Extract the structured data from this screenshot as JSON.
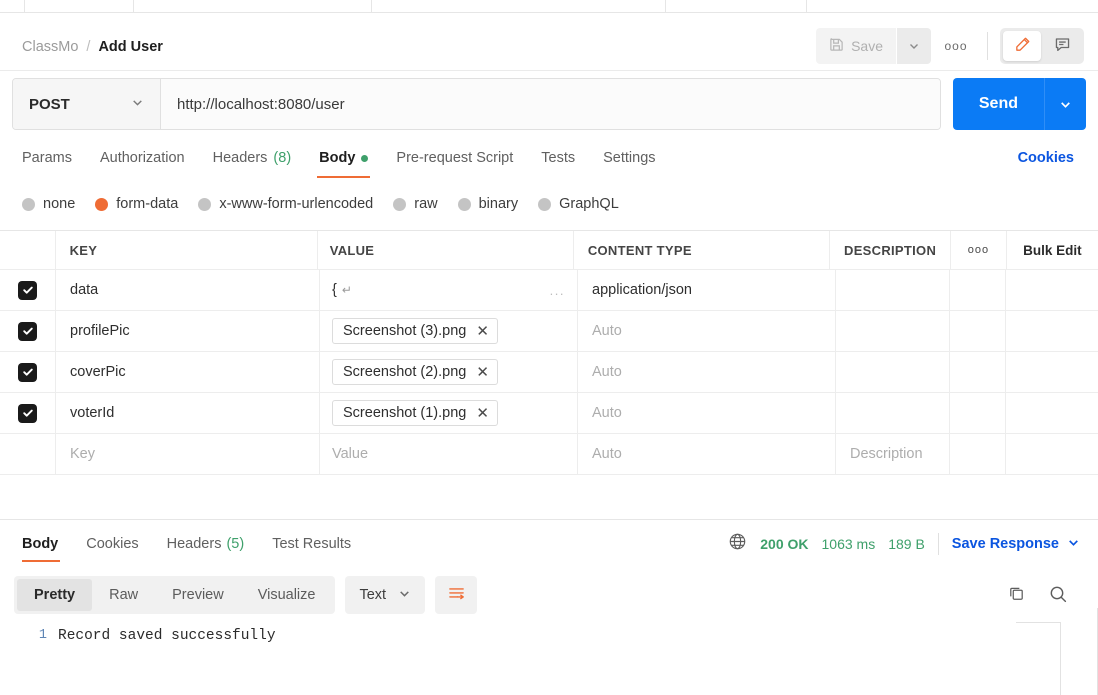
{
  "header": {
    "breadcrumb_collection": "ClassMo",
    "breadcrumb_separator": "/",
    "breadcrumb_request": "Add User",
    "save_label": "Save",
    "save_caret_icon": "chevron-down-icon",
    "more_label": "ooo",
    "edit_icon": "pencil-icon",
    "comment_icon": "comment-icon"
  },
  "request": {
    "method": "POST",
    "method_caret": "chevron-down-icon",
    "url": "http://localhost:8080/user",
    "send_label": "Send",
    "send_caret_icon": "chevron-down-icon",
    "tabs": [
      {
        "label": "Params",
        "count": "",
        "active": false
      },
      {
        "label": "Authorization",
        "count": "",
        "active": false
      },
      {
        "label": "Headers",
        "count": "(8)",
        "active": false
      },
      {
        "label": "Body",
        "count": "",
        "active": true
      },
      {
        "label": "Pre-request Script",
        "count": "",
        "active": false
      },
      {
        "label": "Tests",
        "count": "",
        "active": false
      },
      {
        "label": "Settings",
        "count": "",
        "active": false
      }
    ],
    "cookies_link": "Cookies",
    "body_types": [
      {
        "label": "none",
        "selected": false
      },
      {
        "label": "form-data",
        "selected": true
      },
      {
        "label": "x-www-form-urlencoded",
        "selected": false
      },
      {
        "label": "raw",
        "selected": false
      },
      {
        "label": "binary",
        "selected": false
      },
      {
        "label": "GraphQL",
        "selected": false
      }
    ]
  },
  "form_data_table": {
    "headers": {
      "key": "KEY",
      "value": "VALUE",
      "content_type": "CONTENT TYPE",
      "description": "DESCRIPTION",
      "options_icon": "ooo",
      "bulk_edit": "Bulk Edit"
    },
    "rows": [
      {
        "checked": true,
        "key": "data",
        "value": "{",
        "value_is_file": false,
        "value_return_glyph": "↵",
        "value_overflow": "...",
        "content_type": "application/json",
        "content_type_is_placeholder": false,
        "description": ""
      },
      {
        "checked": true,
        "key": "profilePic",
        "value": "Screenshot (3).png",
        "value_is_file": true,
        "content_type": "Auto",
        "content_type_is_placeholder": true,
        "description": ""
      },
      {
        "checked": true,
        "key": "coverPic",
        "value": "Screenshot (2).png",
        "value_is_file": true,
        "content_type": "Auto",
        "content_type_is_placeholder": true,
        "description": ""
      },
      {
        "checked": true,
        "key": "voterId",
        "value": "Screenshot (1).png",
        "value_is_file": true,
        "content_type": "Auto",
        "content_type_is_placeholder": true,
        "description": ""
      }
    ],
    "empty_row": {
      "key_placeholder": "Key",
      "value_placeholder": "Value",
      "content_type_placeholder": "Auto",
      "description_placeholder": "Description"
    }
  },
  "response": {
    "tabs": [
      {
        "label": "Body",
        "count": "",
        "active": true
      },
      {
        "label": "Cookies",
        "count": "",
        "active": false
      },
      {
        "label": "Headers",
        "count": "(5)",
        "active": false
      },
      {
        "label": "Test Results",
        "count": "",
        "active": false
      }
    ],
    "globe_icon": "globe-icon",
    "status": "200 OK",
    "time": "1063 ms",
    "size": "189 B",
    "save_response_label": "Save Response",
    "save_response_caret": "chevron-down-icon",
    "view_modes": [
      {
        "label": "Pretty",
        "active": true
      },
      {
        "label": "Raw",
        "active": false
      },
      {
        "label": "Preview",
        "active": false
      },
      {
        "label": "Visualize",
        "active": false
      }
    ],
    "format": "Text",
    "format_caret": "chevron-down-icon",
    "wrap_icon": "word-wrap-icon",
    "copy_icon": "copy-icon",
    "search_icon": "search-icon",
    "body_lines": [
      {
        "number": "1",
        "text": "Record saved successfully"
      }
    ]
  },
  "colors": {
    "accent_orange": "#ef6c35",
    "link_blue": "#0b55e0",
    "send_blue": "#0b7bf5",
    "status_green": "#3fa06b"
  }
}
